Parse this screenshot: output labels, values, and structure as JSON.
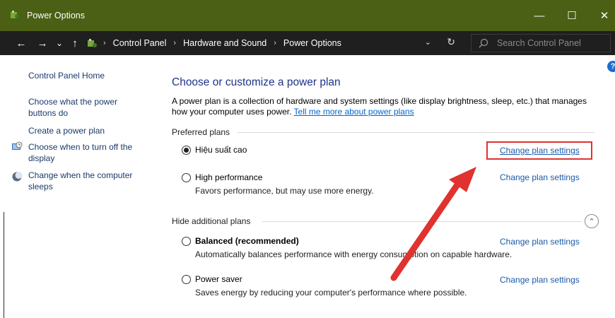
{
  "window": {
    "title": "Power Options",
    "minimize_glyph": "—",
    "maximize_glyph": "☐",
    "close_glyph": "✕"
  },
  "nav": {
    "back_glyph": "←",
    "forward_glyph": "→",
    "recent_glyph": "⌄",
    "up_glyph": "↑",
    "breadcrumbs": [
      "Control Panel",
      "Hardware and Sound",
      "Power Options"
    ],
    "separator": "›",
    "dropdown_glyph": "⌄",
    "refresh_glyph": "↻",
    "search_placeholder": "Search Control Panel"
  },
  "sidebar": {
    "items": [
      {
        "label": "Control Panel Home",
        "icon": null
      },
      {
        "label": "Choose what the power buttons do",
        "icon": null
      },
      {
        "label": "Create a power plan",
        "icon": null
      },
      {
        "label": "Choose when to turn off the display",
        "icon": "display-clock-icon"
      },
      {
        "label": "Change when the computer sleeps",
        "icon": "moon-icon"
      }
    ]
  },
  "main": {
    "heading": "Choose or customize a power plan",
    "description": "A power plan is a collection of hardware and system settings (like display brightness, sleep, etc.) that manages how your computer uses power.",
    "learn_more": "Tell me more about power plans",
    "preferred_label": "Preferred plans",
    "additional_label": "Hide additional plans",
    "change_label": "Change plan settings",
    "plans_preferred": [
      {
        "name": "Hiệu suất cao",
        "selected": true,
        "description": ""
      },
      {
        "name": "High performance",
        "selected": false,
        "description": "Favors performance, but may use more energy."
      }
    ],
    "plans_additional": [
      {
        "name": "Balanced (recommended)",
        "selected": false,
        "description": "Automatically balances performance with energy consumption on capable hardware."
      },
      {
        "name": "Power saver",
        "selected": false,
        "description": "Saves energy by reducing your computer's performance where possible."
      }
    ]
  },
  "help_glyph": "?",
  "collapse_glyph": "⌃",
  "colors": {
    "titlebar": "#4b5f15",
    "navbar": "#1f1f1f",
    "link": "#1a5aa8",
    "heading": "#1e3287",
    "annotation": "#e0322f"
  }
}
